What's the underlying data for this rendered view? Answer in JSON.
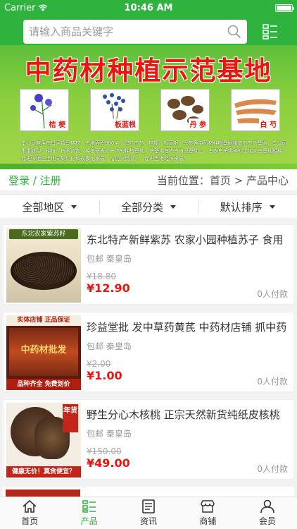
{
  "status": {
    "carrier": "Carrier",
    "time": "10:46 AM"
  },
  "search": {
    "placeholder": "请输入商品关键字"
  },
  "banner": {
    "title": "中药材种植示范基地",
    "herbs": [
      "桔 梗",
      "板蓝根",
      "丹 参",
      "白 芍"
    ],
    "description": "本公司座落在昌河镇马楼村，占地面积800亩。建立白芍、桔梗、板蓝根、丹参等中药材种植基地和加工生产基地。本公司集重收购、种植、技术咨询、种植研发为一体的种植基地。该基地在农户自愿基础上，由农户将零碎的土地交由基地租种，促进该地区土地向集约化和规模化发展，增加农民收入，促进当地经济发展。"
  },
  "nav": {
    "login": "登录",
    "separator": " / ",
    "register": "注册",
    "breadcrumb": "当前位置：首页 > 产品中心"
  },
  "filters": [
    "全部地区",
    "全部分类",
    "默认排序"
  ],
  "products": [
    {
      "title": "东北特产新鲜紫苏 农家小园种植苏子 食用",
      "location": "包邮 秦皇岛",
      "old_price": "¥18.80",
      "price": "¥12.90",
      "buyers": "0人付款",
      "thumb_text": "东北农家紫苏籽"
    },
    {
      "title": "珍益堂批 发中草药黄芪 中药材店铺 抓中药",
      "location": "包邮 秦皇岛",
      "old_price": "¥2.00",
      "price": "¥1.00",
      "buyers": "0人付款",
      "thumb_text_top": "实体店铺  正品保证",
      "thumb_text_mid": "中药材批发",
      "thumb_text_bot": "品种齐全  免费划价"
    },
    {
      "title": "野生分心木核桃 正宗天然新货纯纸皮核桃",
      "location": "包邮 秦皇岛",
      "old_price": "¥150.00",
      "price": "¥49.00",
      "buyers": "0人付款",
      "thumb_text_bot": "健康无价！莫贪便宜？",
      "thumb_badge": "年货"
    }
  ],
  "tabs": [
    {
      "label": "首页",
      "icon": "home-icon"
    },
    {
      "label": "产品",
      "icon": "list-icon"
    },
    {
      "label": "资讯",
      "icon": "news-icon"
    },
    {
      "label": "商铺",
      "icon": "shop-icon"
    },
    {
      "label": "会员",
      "icon": "user-icon"
    }
  ],
  "colors": {
    "brand": "#2fb33e",
    "price": "#e8160e"
  }
}
